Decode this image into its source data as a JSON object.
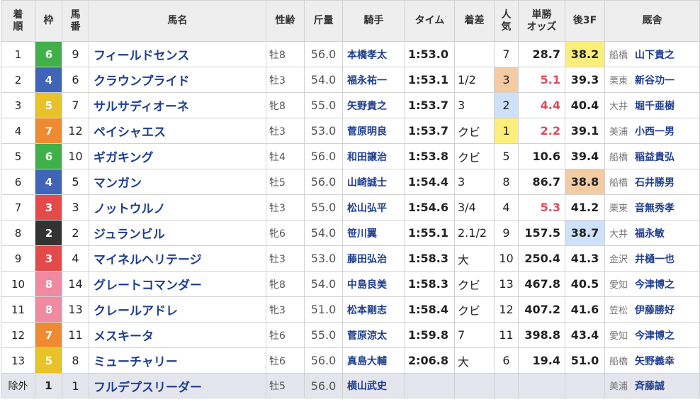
{
  "colors": {
    "frame": {
      "1": "#ffffff",
      "2": "#333333",
      "3": "#e34a4a",
      "4": "#3f64b8",
      "5": "#e7c228",
      "6": "#3fb04a",
      "7": "#ee8a31",
      "8": "#ef8aa1"
    },
    "pop_highlight": {
      "1": "#fbee7a",
      "2": "#cfe0fb",
      "3": "#f5cba3"
    },
    "last3f_highlight": {
      "1": "#fbee7a",
      "2": "#f5cba3",
      "3": "#cfe0fb"
    }
  },
  "headers": {
    "rank": [
      "着",
      "順"
    ],
    "frame": "枠",
    "number": [
      "馬",
      "番"
    ],
    "horse": "馬名",
    "sexage": "性齢",
    "weight": "斤量",
    "jockey": "騎手",
    "time": "タイム",
    "margin": "着差",
    "pop": [
      "人",
      "気"
    ],
    "odds": [
      "単勝",
      "オッズ"
    ],
    "last3f": "後3F",
    "stable": "厩舎"
  },
  "rows": [
    {
      "rank": "1",
      "frame": "6",
      "num": "9",
      "horse": "フィールドセンス",
      "sexage": "牡8",
      "weight": "56.0",
      "jockey": "本橋孝太",
      "time": "1:53.0",
      "margin": "",
      "pop": "7",
      "odds": "28.7",
      "last3f": "38.2",
      "loc": "船橋",
      "trainer": "山下貴之",
      "last3f_rank": "1"
    },
    {
      "rank": "2",
      "frame": "4",
      "num": "6",
      "horse": "クラウンプライド",
      "sexage": "牡3",
      "weight": "54.0",
      "jockey": "福永祐一",
      "time": "1:53.1",
      "margin": "1/2",
      "pop": "3",
      "odds": "5.1",
      "last3f": "39.3",
      "loc": "栗東",
      "trainer": "新谷功一",
      "pop_rank": "3",
      "odds_hot": true
    },
    {
      "rank": "3",
      "frame": "5",
      "num": "7",
      "horse": "サルサディオーネ",
      "sexage": "牝8",
      "weight": "55.0",
      "jockey": "矢野貴之",
      "time": "1:53.7",
      "margin": "3",
      "pop": "2",
      "odds": "4.4",
      "last3f": "40.4",
      "loc": "大井",
      "trainer": "堀千亜樹",
      "pop_rank": "2",
      "odds_hot": true
    },
    {
      "rank": "4",
      "frame": "7",
      "num": "12",
      "horse": "ペイシャエス",
      "sexage": "牡3",
      "weight": "53.0",
      "jockey": "菅原明良",
      "time": "1:53.7",
      "margin": "クビ",
      "pop": "1",
      "odds": "2.2",
      "last3f": "39.1",
      "loc": "美浦",
      "trainer": "小西一男",
      "pop_rank": "1",
      "odds_hot": true
    },
    {
      "rank": "5",
      "frame": "6",
      "num": "10",
      "horse": "ギガキング",
      "sexage": "牡4",
      "weight": "56.0",
      "jockey": "和田譲治",
      "time": "1:53.8",
      "margin": "クビ",
      "pop": "5",
      "odds": "10.6",
      "last3f": "39.4",
      "loc": "船橋",
      "trainer": "稲益貴弘"
    },
    {
      "rank": "6",
      "frame": "4",
      "num": "5",
      "horse": "マンガン",
      "sexage": "牡5",
      "weight": "56.0",
      "jockey": "山崎誠士",
      "time": "1:54.4",
      "margin": "3",
      "pop": "8",
      "odds": "86.7",
      "last3f": "38.8",
      "loc": "船橋",
      "trainer": "石井勝男",
      "last3f_rank": "2"
    },
    {
      "rank": "7",
      "frame": "3",
      "num": "3",
      "horse": "ノットウルノ",
      "sexage": "牡3",
      "weight": "55.0",
      "jockey": "松山弘平",
      "time": "1:54.6",
      "margin": "3/4",
      "pop": "4",
      "odds": "5.3",
      "last3f": "41.2",
      "loc": "栗東",
      "trainer": "音無秀孝",
      "odds_hot": true
    },
    {
      "rank": "8",
      "frame": "2",
      "num": "2",
      "horse": "ジュランビル",
      "sexage": "牝6",
      "weight": "54.0",
      "jockey": "笹川翼",
      "time": "1:55.1",
      "margin": "2.1/2",
      "pop": "9",
      "odds": "157.5",
      "last3f": "38.7",
      "loc": "大井",
      "trainer": "福永敏",
      "last3f_rank": "3"
    },
    {
      "rank": "9",
      "frame": "3",
      "num": "4",
      "horse": "マイネルヘリテージ",
      "sexage": "牡3",
      "weight": "53.0",
      "jockey": "藤田弘治",
      "time": "1:58.3",
      "margin": "大",
      "pop": "10",
      "odds": "250.4",
      "last3f": "41.3",
      "loc": "金沢",
      "trainer": "井樋一也"
    },
    {
      "rank": "10",
      "frame": "8",
      "num": "14",
      "horse": "グレートコマンダー",
      "sexage": "牝8",
      "weight": "54.0",
      "jockey": "中島良美",
      "time": "1:58.3",
      "margin": "クビ",
      "pop": "13",
      "odds": "467.8",
      "last3f": "40.5",
      "loc": "愛知",
      "trainer": "今津博之"
    },
    {
      "rank": "11",
      "frame": "8",
      "num": "13",
      "horse": "クレールアドレ",
      "sexage": "牝3",
      "weight": "51.0",
      "jockey": "松本剛志",
      "time": "1:58.4",
      "margin": "クビ",
      "pop": "12",
      "odds": "407.2",
      "last3f": "41.6",
      "loc": "笠松",
      "trainer": "伊藤勝好"
    },
    {
      "rank": "12",
      "frame": "7",
      "num": "11",
      "horse": "メスキータ",
      "sexage": "牡6",
      "weight": "55.0",
      "jockey": "菅原涼太",
      "time": "1:59.8",
      "margin": "7",
      "pop": "11",
      "odds": "398.8",
      "last3f": "43.4",
      "loc": "愛知",
      "trainer": "今津博之"
    },
    {
      "rank": "13",
      "frame": "5",
      "num": "8",
      "horse": "ミューチャリー",
      "sexage": "牡6",
      "weight": "56.0",
      "jockey": "真島大輔",
      "time": "2:06.8",
      "margin": "大",
      "pop": "6",
      "odds": "19.4",
      "last3f": "51.0",
      "loc": "船橋",
      "trainer": "矢野義幸"
    }
  ],
  "excluded": {
    "rank": "除外",
    "frame": "1",
    "num": "1",
    "horse": "フルデプスリーダー",
    "sexage": "牡5",
    "weight": "56.0",
    "jockey": "横山武史",
    "time": "",
    "margin": "",
    "pop": "",
    "odds": "",
    "last3f": "",
    "loc": "美浦",
    "trainer": "斉藤誠"
  }
}
